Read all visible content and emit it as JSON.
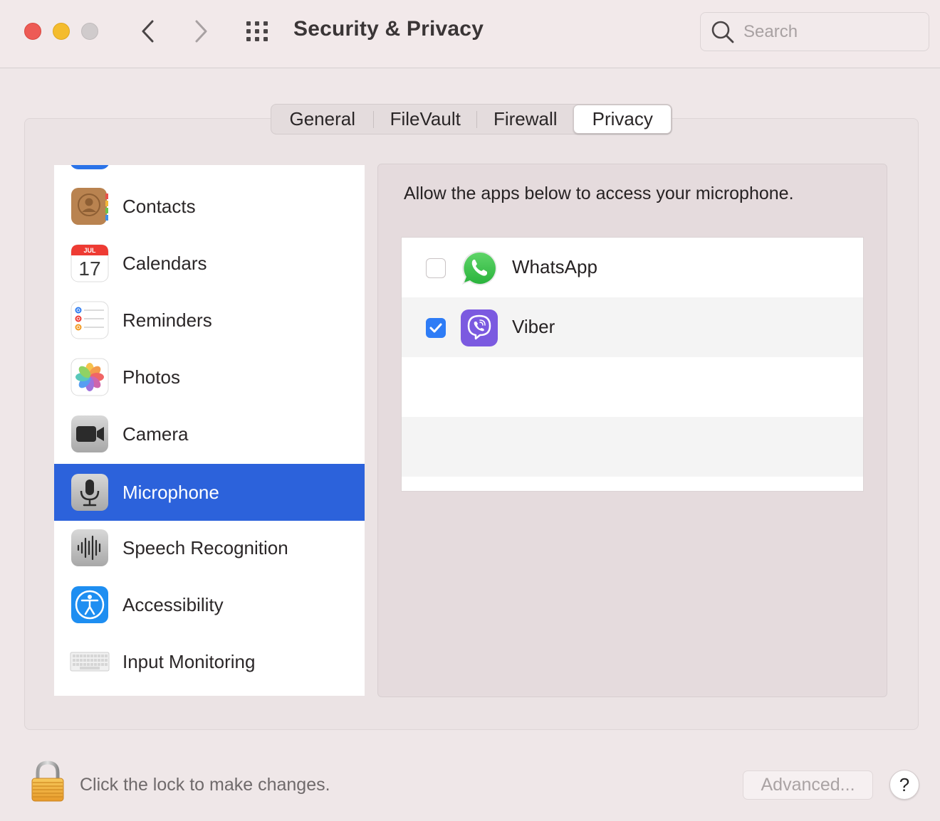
{
  "window": {
    "title": "Security & Privacy",
    "search_placeholder": "Search"
  },
  "tabs": [
    {
      "label": "General",
      "selected": false
    },
    {
      "label": "FileVault",
      "selected": false
    },
    {
      "label": "Firewall",
      "selected": false
    },
    {
      "label": "Privacy",
      "selected": true
    }
  ],
  "sidebar": {
    "items": [
      {
        "label": "Contacts",
        "icon": "contacts-icon",
        "selected": false
      },
      {
        "label": "Calendars",
        "icon": "calendar-icon",
        "selected": false,
        "icon_month": "JUL",
        "icon_day": "17"
      },
      {
        "label": "Reminders",
        "icon": "reminders-icon",
        "selected": false
      },
      {
        "label": "Photos",
        "icon": "photos-icon",
        "selected": false
      },
      {
        "label": "Camera",
        "icon": "camera-icon",
        "selected": false
      },
      {
        "label": "Microphone",
        "icon": "microphone-icon",
        "selected": true
      },
      {
        "label": "Speech Recognition",
        "icon": "speech-recognition-icon",
        "selected": false
      },
      {
        "label": "Accessibility",
        "icon": "accessibility-icon",
        "selected": false
      },
      {
        "label": "Input Monitoring",
        "icon": "keyboard-icon",
        "selected": false
      }
    ]
  },
  "main": {
    "description": "Allow the apps below to access your microphone.",
    "apps": [
      {
        "name": "WhatsApp",
        "checked": false,
        "icon": "whatsapp-icon"
      },
      {
        "name": "Viber",
        "checked": true,
        "icon": "viber-icon"
      }
    ]
  },
  "footer": {
    "lock_text": "Click the lock to make changes.",
    "advanced_label": "Advanced...",
    "help_label": "?"
  },
  "colors": {
    "selection": "#2c62db",
    "checkbox_checked": "#2e7cf6",
    "close": "#ed5b55",
    "minimize": "#f4bc2e"
  }
}
